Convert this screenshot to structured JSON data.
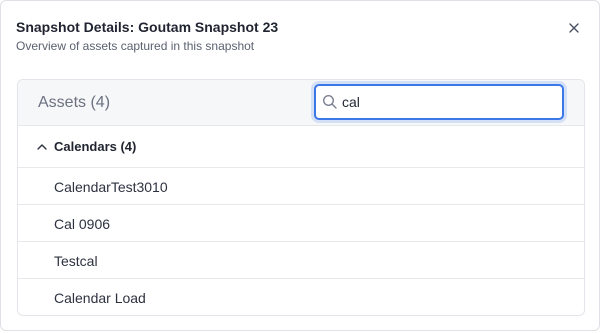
{
  "dialog": {
    "title": "Snapshot Details: Goutam Snapshot 23",
    "subtitle": "Overview of assets captured in this snapshot",
    "close_icon": "close-icon"
  },
  "assets": {
    "title": "Assets (4)",
    "search": {
      "value": "cal",
      "icon": "search-icon"
    },
    "groups": [
      {
        "label": "Calendars (4)",
        "expanded": true,
        "icon": "chevron-up-icon",
        "items": [
          {
            "label": "CalendarTest3010"
          },
          {
            "label": "Cal 0906"
          },
          {
            "label": "Testcal"
          },
          {
            "label": "Calendar Load"
          }
        ]
      }
    ]
  },
  "colors": {
    "accent": "#3b78e7",
    "border": "#e3e5ea",
    "header_bg": "#f6f7f9",
    "text_primary": "#1f2430",
    "text_muted": "#6b7180"
  }
}
